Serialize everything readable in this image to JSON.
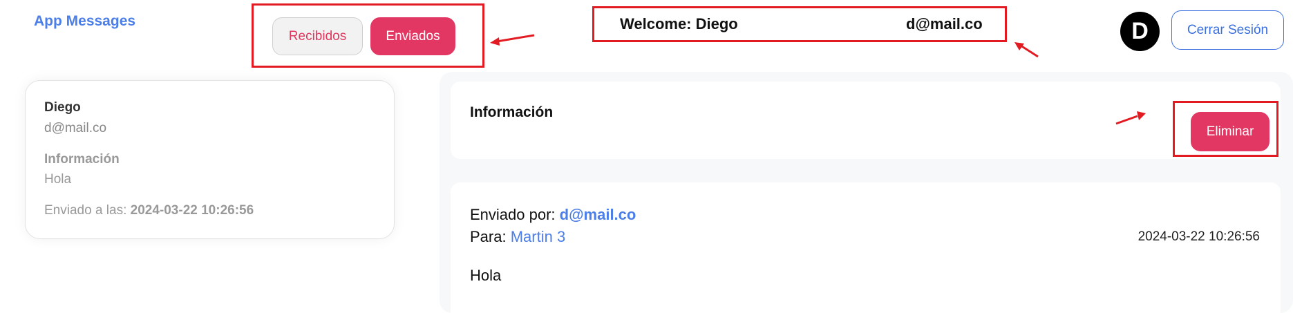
{
  "header": {
    "brand": "App Messages",
    "tabs": [
      {
        "label": "Recibidos",
        "active": false
      },
      {
        "label": "Enviados",
        "active": true
      }
    ],
    "welcome_label": "Welcome: Diego",
    "welcome_email": "d@mail.co",
    "avatar_letter": "D",
    "logout_label": "Cerrar Sesión"
  },
  "message_list": [
    {
      "name": "Diego",
      "email": "d@mail.co",
      "info_title": "Información",
      "info_text": "Hola",
      "sent_prefix": "Enviado a las: ",
      "sent_at": "2024-03-22 10:26:56"
    }
  ],
  "detail": {
    "title": "Información",
    "delete_label": "Eliminar",
    "from_prefix": "Enviado por: ",
    "from_value": "d@mail.co",
    "to_prefix": "Para: ",
    "to_value": "Martin 3",
    "date": "2024-03-22 10:26:56",
    "body": "Hola"
  },
  "colors": {
    "accent_blue": "#4c7ee8",
    "accent_pink": "#e23762",
    "annotation_red": "#e21b22"
  }
}
